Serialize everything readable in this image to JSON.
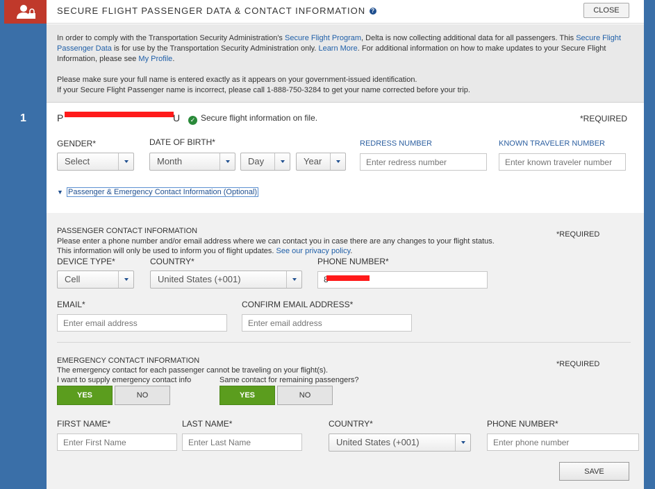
{
  "header": {
    "title": "SECURE FLIGHT PASSENGER DATA & CONTACT INFORMATION",
    "close_label": "CLOSE"
  },
  "info": {
    "p1_a": "In order to comply with the Transportation Security Administration's ",
    "p1_link1": "Secure Flight Program",
    "p1_b": ", Delta is now collecting additional data for all passengers. This ",
    "p1_link2": "Secure Flight Passenger Data",
    "p1_c": " is for use by the Transportation Security Administration only. ",
    "p1_link3": "Learn More",
    "p1_d": ". For additional information on how to make updates to your Secure Flight Information, please see ",
    "p1_link4": "My Profile",
    "p1_e": ".",
    "p2_line1": "Please make sure your full name is entered exactly as it appears on your government-issued identification.",
    "p2_line2": "If your Secure Flight Passenger name is incorrect, please call 1-888-750-3284 to get your name corrected before your trip."
  },
  "passenger": {
    "number": "1",
    "name_first_char": "P",
    "name_last_char": "U",
    "secure_status": "Secure flight information on file.",
    "required": "*REQUIRED",
    "gender_label": "GENDER*",
    "gender_value": "Select",
    "dob_label": "DATE OF BIRTH*",
    "month_value": "Month",
    "day_value": "Day",
    "year_value": "Year",
    "redress_label": "REDRESS NUMBER",
    "redress_placeholder": "Enter redress number",
    "ktn_label": "KNOWN TRAVELER NUMBER",
    "ktn_placeholder": "Enter known traveler number",
    "expander_label": "Passenger & Emergency Contact Information (Optional)"
  },
  "contact": {
    "heading": "PASSENGER CONTACT INFORMATION",
    "desc1": "Please enter a phone number and/or email address where we can contact you in case there are any changes to your flight status.",
    "desc2": "This information will only be used to inform you of flight updates. ",
    "privacy_link": "See our privacy policy",
    "desc2_end": ".",
    "required": "*REQUIRED",
    "device_label": "DEVICE TYPE*",
    "device_value": "Cell",
    "country_label": "COUNTRY*",
    "country_value": "United States (+001)",
    "phone_label": "PHONE NUMBER*",
    "phone_visible_prefix": "8",
    "email_label": "EMAIL*",
    "email_placeholder": "Enter email address",
    "confirm_email_label": "CONFIRM EMAIL ADDRESS*",
    "confirm_email_placeholder": "Enter email address"
  },
  "emergency": {
    "heading": "EMERGENCY CONTACT INFORMATION",
    "desc": "The emergency contact for each passenger cannot be traveling on your flight(s).",
    "required": "*REQUIRED",
    "supply_label": "I want to supply emergency contact info",
    "same_label": "Same contact for remaining passengers?",
    "yes_label": "YES",
    "no_label": "NO",
    "first_name_label": "FIRST NAME*",
    "first_name_placeholder": "Enter First Name",
    "last_name_label": "LAST NAME*",
    "last_name_placeholder": "Enter Last Name",
    "country_label": "COUNTRY*",
    "country_value": "United States (+001)",
    "phone_label": "PHONE NUMBER*",
    "phone_placeholder": "Enter phone number",
    "save_label": "SAVE"
  },
  "colors": {
    "rail": "#3a6fa8",
    "icon_bg": "#c0392b",
    "toggle_on": "#5b9d1e",
    "link": "#1f5fa8",
    "redaction": "#ff1a1a"
  }
}
